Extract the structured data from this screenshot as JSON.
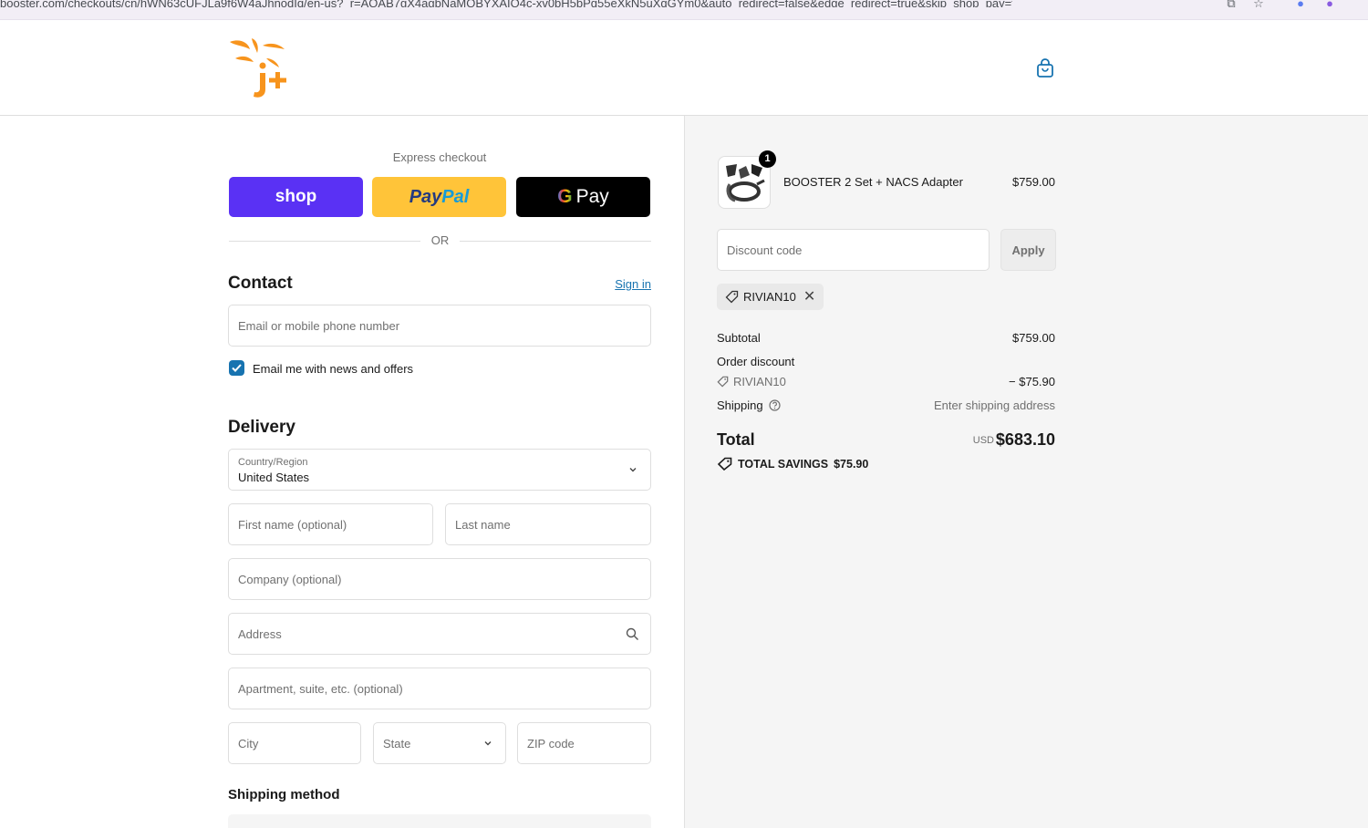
{
  "browser": {
    "url": "booster.com/checkouts/cn/hWN63cUFJLa9f6W4aJhnodIq/en-us?_r=AQAB7gX4agbNaMQBYXAIQ4c-xv0bH5bPq55eXkN5uXqGYm0&auto_redirect=false&edge_redirect=true&skip_shop_pay=true"
  },
  "header": {
    "logo_icon": "j-plus-logo",
    "cart_icon": "shopping-bag-icon"
  },
  "express": {
    "label": "Express checkout",
    "shop_label": "shop",
    "paypal_label_a": "Pay",
    "paypal_label_b": "Pal",
    "gpay_g": "G",
    "gpay_label": "Pay",
    "or_label": "OR"
  },
  "contact": {
    "title": "Contact",
    "signin_label": "Sign in",
    "email_placeholder": "Email or mobile phone number",
    "newsletter_label": "Email me with news and offers",
    "newsletter_checked": true
  },
  "delivery": {
    "title": "Delivery",
    "country_label": "Country/Region",
    "country_value": "United States",
    "first_name_placeholder": "First name (optional)",
    "last_name_placeholder": "Last name",
    "company_placeholder": "Company (optional)",
    "address_placeholder": "Address",
    "apartment_placeholder": "Apartment, suite, etc. (optional)",
    "city_placeholder": "City",
    "state_placeholder": "State",
    "zip_placeholder": "ZIP code"
  },
  "shipping_method": {
    "title": "Shipping method"
  },
  "summary": {
    "item": {
      "quantity": "1",
      "name": "BOOSTER 2 Set + NACS Adapter",
      "price": "$759.00"
    },
    "discount_placeholder": "Discount code",
    "apply_label": "Apply",
    "applied_code": "RIVIAN10",
    "subtotal_label": "Subtotal",
    "subtotal_value": "$759.00",
    "order_discount_label": "Order discount",
    "order_discount_code": "RIVIAN10",
    "order_discount_value": "− $75.90",
    "shipping_label": "Shipping",
    "shipping_value": "Enter shipping address",
    "total_label": "Total",
    "total_currency": "USD",
    "total_value": "$683.10",
    "savings_label": "TOTAL SAVINGS",
    "savings_value": "$75.90"
  },
  "colors": {
    "shop_purple": "#5a31f4",
    "paypal_yellow": "#ffc439",
    "link_blue": "#1773b0",
    "logo_orange": "#f7941d"
  }
}
